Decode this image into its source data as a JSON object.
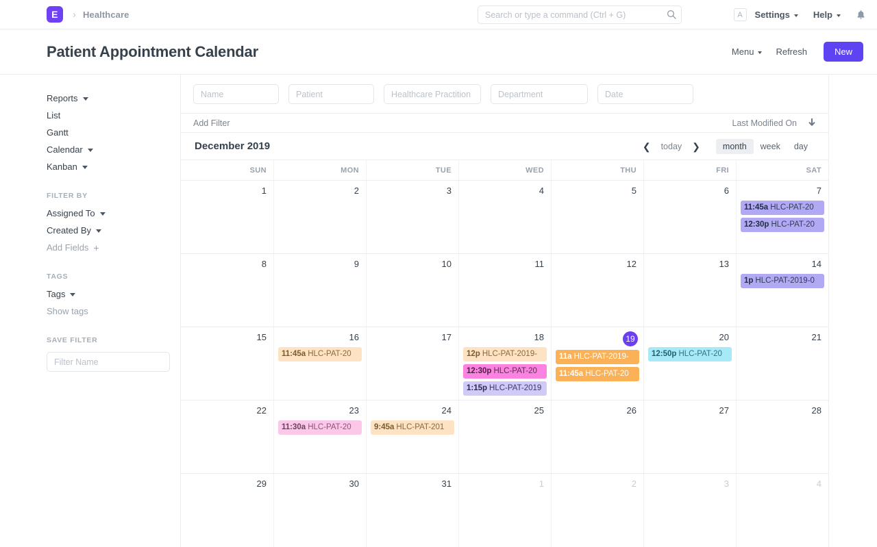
{
  "navbar": {
    "logo_text": "E",
    "breadcrumb": "Healthcare",
    "search_placeholder": "Search or type a command (Ctrl + G)",
    "search_value": "",
    "avatar_initial": "A",
    "settings_label": "Settings",
    "help_label": "Help"
  },
  "page": {
    "title": "Patient Appointment Calendar",
    "menu_label": "Menu",
    "refresh_label": "Refresh",
    "new_label": "New"
  },
  "sidebar": {
    "views": [
      {
        "label": "Reports",
        "has_caret": true
      },
      {
        "label": "List",
        "has_caret": false
      },
      {
        "label": "Gantt",
        "has_caret": false
      },
      {
        "label": "Calendar",
        "has_caret": true
      },
      {
        "label": "Kanban",
        "has_caret": true
      }
    ],
    "filter_by_label": "FILTER BY",
    "filters": [
      {
        "label": "Assigned To"
      },
      {
        "label": "Created By"
      }
    ],
    "add_fields_label": "Add Fields",
    "tags_label": "TAGS",
    "tags_item": "Tags",
    "show_tags_label": "Show tags",
    "save_filter_label": "SAVE FILTER",
    "filter_name_placeholder": "Filter Name",
    "filter_name_value": ""
  },
  "filters": {
    "fields": [
      {
        "placeholder": "Name",
        "value": ""
      },
      {
        "placeholder": "Patient",
        "value": ""
      },
      {
        "placeholder": "Healthcare Practition",
        "value": ""
      },
      {
        "placeholder": "Department",
        "value": ""
      },
      {
        "placeholder": "Date",
        "value": ""
      }
    ],
    "add_filter_label": "Add Filter",
    "sort_label": "Last Modified On"
  },
  "calendar": {
    "title": "December 2019",
    "today_label": "today",
    "views": [
      {
        "label": "month",
        "active": true
      },
      {
        "label": "week",
        "active": false
      },
      {
        "label": "day",
        "active": false
      }
    ],
    "day_headers": [
      "SUN",
      "MON",
      "TUE",
      "WED",
      "THU",
      "FRI",
      "SAT"
    ],
    "weeks": [
      [
        {
          "num": "1",
          "other": false,
          "today": false,
          "events": []
        },
        {
          "num": "2",
          "other": false,
          "today": false,
          "events": []
        },
        {
          "num": "3",
          "other": false,
          "today": false,
          "events": []
        },
        {
          "num": "4",
          "other": false,
          "today": false,
          "events": []
        },
        {
          "num": "5",
          "other": false,
          "today": false,
          "events": []
        },
        {
          "num": "6",
          "other": false,
          "today": false,
          "events": []
        },
        {
          "num": "7",
          "other": false,
          "today": false,
          "events": [
            {
              "time": "11:45a",
              "title": "HLC-PAT-20",
              "color": "ev-purple"
            },
            {
              "time": "12:30p",
              "title": "HLC-PAT-20",
              "color": "ev-purple"
            }
          ]
        }
      ],
      [
        {
          "num": "8",
          "other": false,
          "today": false,
          "events": []
        },
        {
          "num": "9",
          "other": false,
          "today": false,
          "events": []
        },
        {
          "num": "10",
          "other": false,
          "today": false,
          "events": []
        },
        {
          "num": "11",
          "other": false,
          "today": false,
          "events": []
        },
        {
          "num": "12",
          "other": false,
          "today": false,
          "events": []
        },
        {
          "num": "13",
          "other": false,
          "today": false,
          "events": []
        },
        {
          "num": "14",
          "other": false,
          "today": false,
          "events": [
            {
              "time": "1p",
              "title": "HLC-PAT-2019-0",
              "color": "ev-purple"
            }
          ]
        }
      ],
      [
        {
          "num": "15",
          "other": false,
          "today": false,
          "events": []
        },
        {
          "num": "16",
          "other": false,
          "today": false,
          "events": [
            {
              "time": "11:45a",
              "title": "HLC-PAT-20",
              "color": "ev-peach"
            }
          ]
        },
        {
          "num": "17",
          "other": false,
          "today": false,
          "events": []
        },
        {
          "num": "18",
          "other": false,
          "today": false,
          "events": [
            {
              "time": "12p",
              "title": "HLC-PAT-2019-",
              "color": "ev-peach"
            },
            {
              "time": "12:30p",
              "title": "HLC-PAT-20",
              "color": "ev-magenta"
            },
            {
              "time": "1:15p",
              "title": "HLC-PAT-2019",
              "color": "ev-lilac"
            }
          ]
        },
        {
          "num": "19",
          "other": false,
          "today": true,
          "events": [
            {
              "time": "11a",
              "title": "HLC-PAT-2019-",
              "color": "ev-orange"
            },
            {
              "time": "11:45a",
              "title": "HLC-PAT-20",
              "color": "ev-orange"
            }
          ]
        },
        {
          "num": "20",
          "other": false,
          "today": false,
          "events": [
            {
              "time": "12:50p",
              "title": "HLC-PAT-20",
              "color": "ev-cyan"
            }
          ]
        },
        {
          "num": "21",
          "other": false,
          "today": false,
          "events": []
        }
      ],
      [
        {
          "num": "22",
          "other": false,
          "today": false,
          "events": []
        },
        {
          "num": "23",
          "other": false,
          "today": false,
          "events": [
            {
              "time": "11:30a",
              "title": "HLC-PAT-20",
              "color": "ev-pink"
            }
          ]
        },
        {
          "num": "24",
          "other": false,
          "today": false,
          "events": [
            {
              "time": "9:45a",
              "title": "HLC-PAT-201",
              "color": "ev-peach"
            }
          ]
        },
        {
          "num": "25",
          "other": false,
          "today": false,
          "events": []
        },
        {
          "num": "26",
          "other": false,
          "today": false,
          "events": []
        },
        {
          "num": "27",
          "other": false,
          "today": false,
          "events": []
        },
        {
          "num": "28",
          "other": false,
          "today": false,
          "events": []
        }
      ],
      [
        {
          "num": "29",
          "other": false,
          "today": false,
          "events": []
        },
        {
          "num": "30",
          "other": false,
          "today": false,
          "events": []
        },
        {
          "num": "31",
          "other": false,
          "today": false,
          "events": []
        },
        {
          "num": "1",
          "other": true,
          "today": false,
          "events": []
        },
        {
          "num": "2",
          "other": true,
          "today": false,
          "events": []
        },
        {
          "num": "3",
          "other": true,
          "today": false,
          "events": []
        },
        {
          "num": "4",
          "other": true,
          "today": false,
          "events": []
        }
      ]
    ]
  },
  "colors": {
    "brand": "#6e41f5",
    "primary_button": "#5e43f3",
    "today_badge": "#6c3ff0",
    "event_purple": "#b2a9f4",
    "event_lilac": "#cfcaf8",
    "event_peach": "#fde3c4",
    "event_orange": "#fbb157",
    "event_pink": "#fbc8ea",
    "event_magenta": "#fb82e0",
    "event_cyan": "#a8e9f7"
  }
}
